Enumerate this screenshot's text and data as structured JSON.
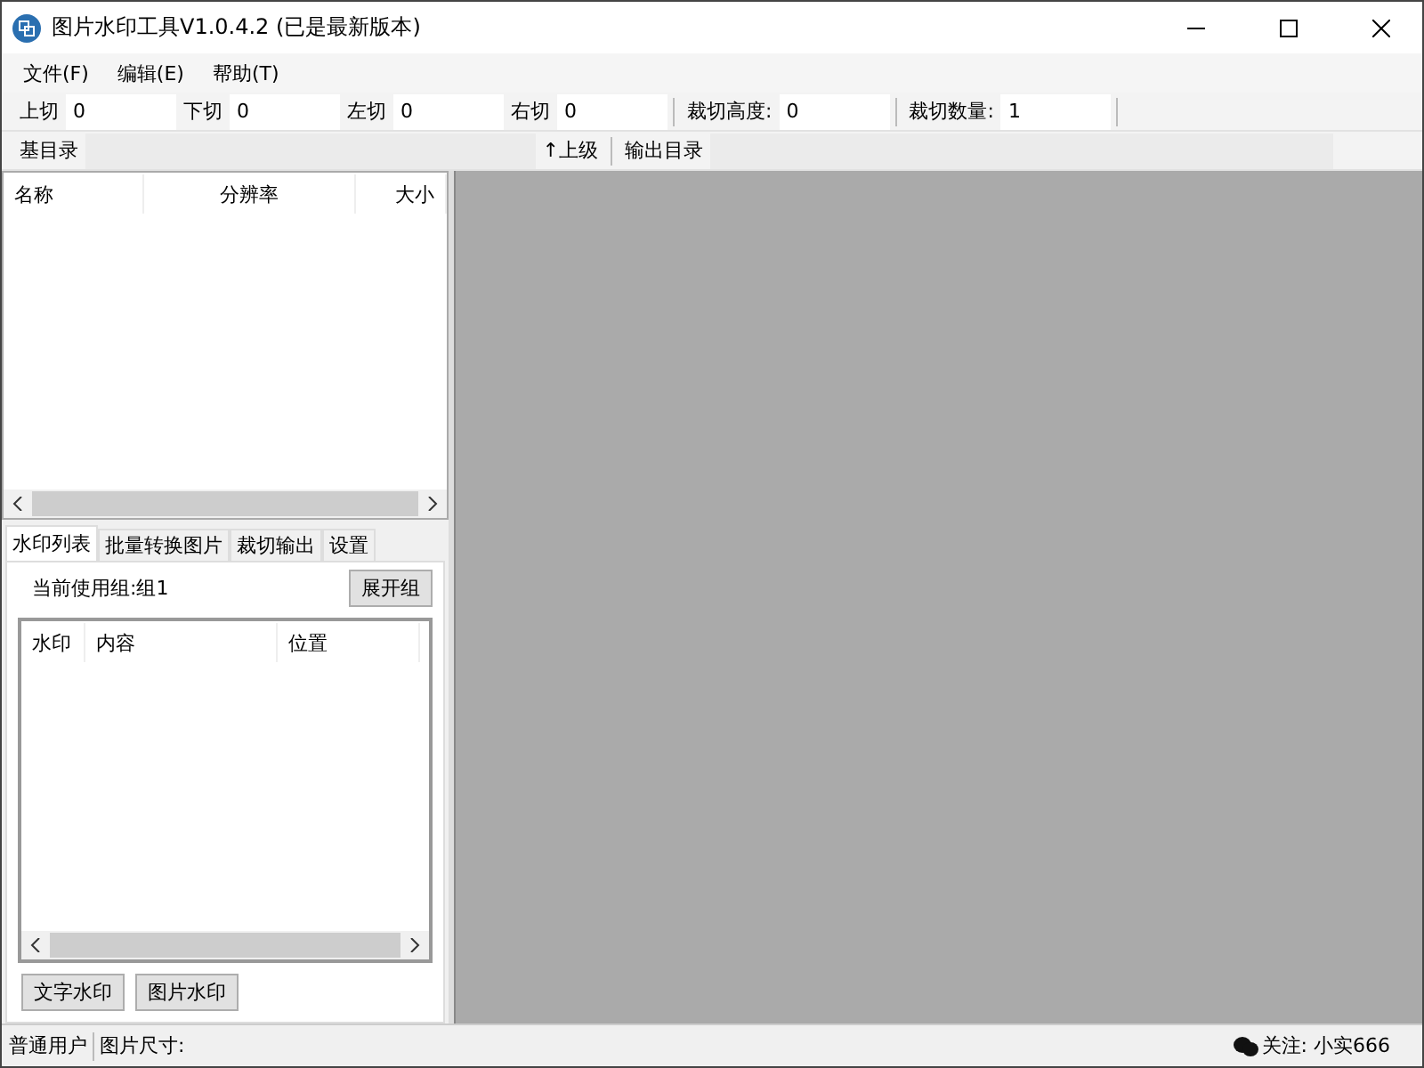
{
  "window": {
    "title": "图片水印工具V1.0.4.2 (已是最新版本)"
  },
  "menu": [
    "文件(F)",
    "编辑(E)",
    "帮助(T)"
  ],
  "crop_fields": [
    {
      "label": "上切",
      "value": "0"
    },
    {
      "label": "下切",
      "value": "0"
    },
    {
      "label": "左切",
      "value": "0"
    },
    {
      "label": "右切",
      "value": "0"
    },
    {
      "label": "裁切高度:",
      "value": "0"
    },
    {
      "label": "裁切数量:",
      "value": "1"
    }
  ],
  "dir_bar": {
    "label": "基目录",
    "up": "↑上级",
    "output": "输出目录"
  },
  "file_table": {
    "columns": [
      "名称",
      "分辨率",
      "大小"
    ]
  },
  "tabs": [
    {
      "label": "水印列表",
      "selected": true
    },
    {
      "label": "批量转换图片",
      "selected": false
    },
    {
      "label": "裁切输出",
      "selected": false
    },
    {
      "label": "设置",
      "selected": false
    }
  ],
  "group": {
    "text": "当前使用组:组1",
    "button": "展开组"
  },
  "watermark_table": {
    "columns": [
      "水印",
      "内容",
      "位置"
    ]
  },
  "buttons": [
    "文字水印",
    "图片水印"
  ],
  "status_bar": {
    "user": "普通用户",
    "size": "图片尺寸:",
    "follow": "关注: 小实666"
  }
}
